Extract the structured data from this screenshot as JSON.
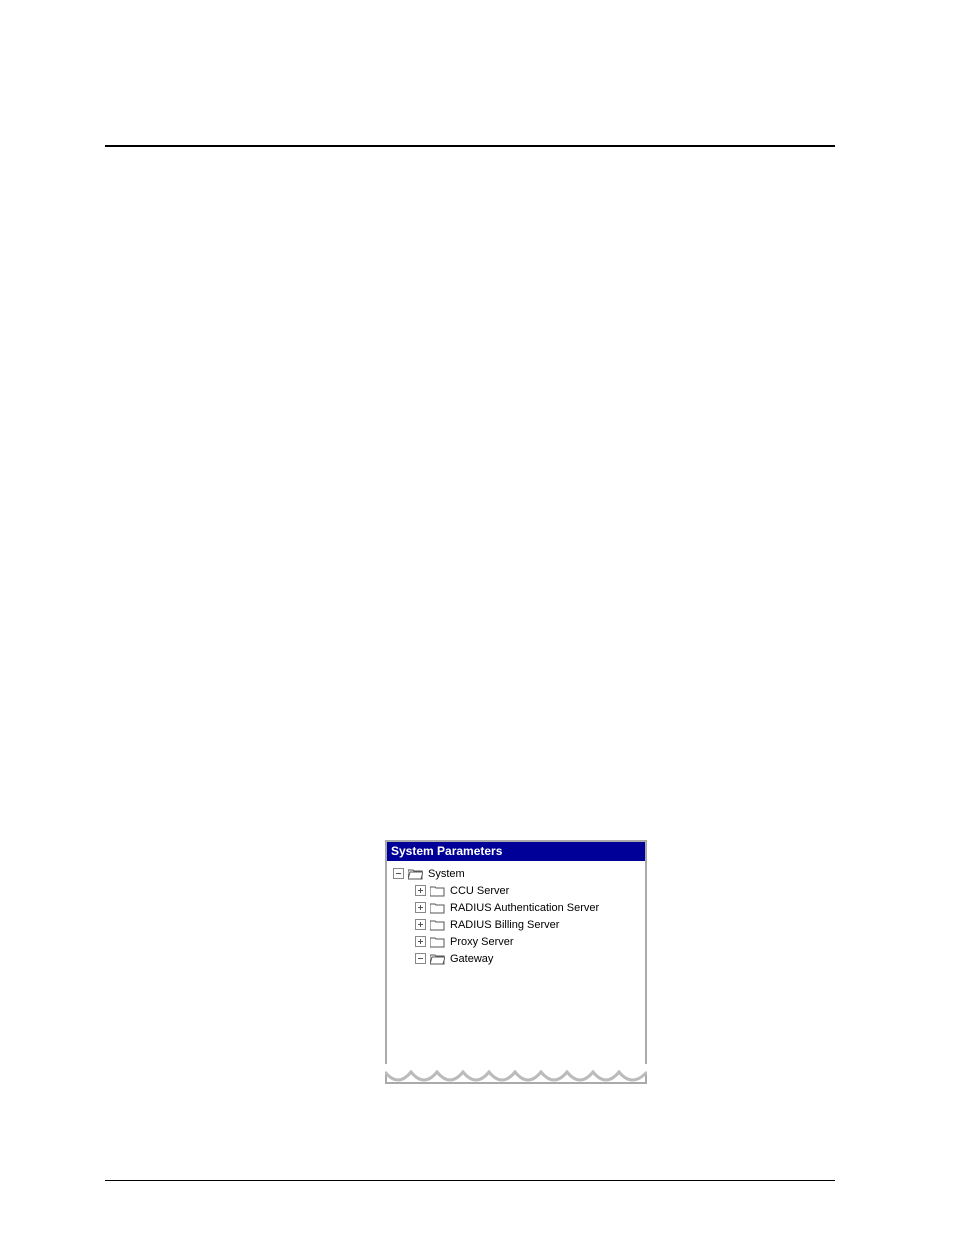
{
  "panel": {
    "title": "System Parameters",
    "tree": {
      "root": {
        "label": "System",
        "expander": "minus"
      },
      "children": [
        {
          "key": "ccu",
          "label": "CCU Server",
          "expander": "plus"
        },
        {
          "key": "radauth",
          "label": "RADIUS Authentication Server",
          "expander": "plus"
        },
        {
          "key": "radbill",
          "label": "RADIUS Billing Server",
          "expander": "plus"
        },
        {
          "key": "proxy",
          "label": "Proxy Server",
          "expander": "plus"
        },
        {
          "key": "gateway",
          "label": "Gateway",
          "expander": "minus"
        }
      ]
    }
  }
}
